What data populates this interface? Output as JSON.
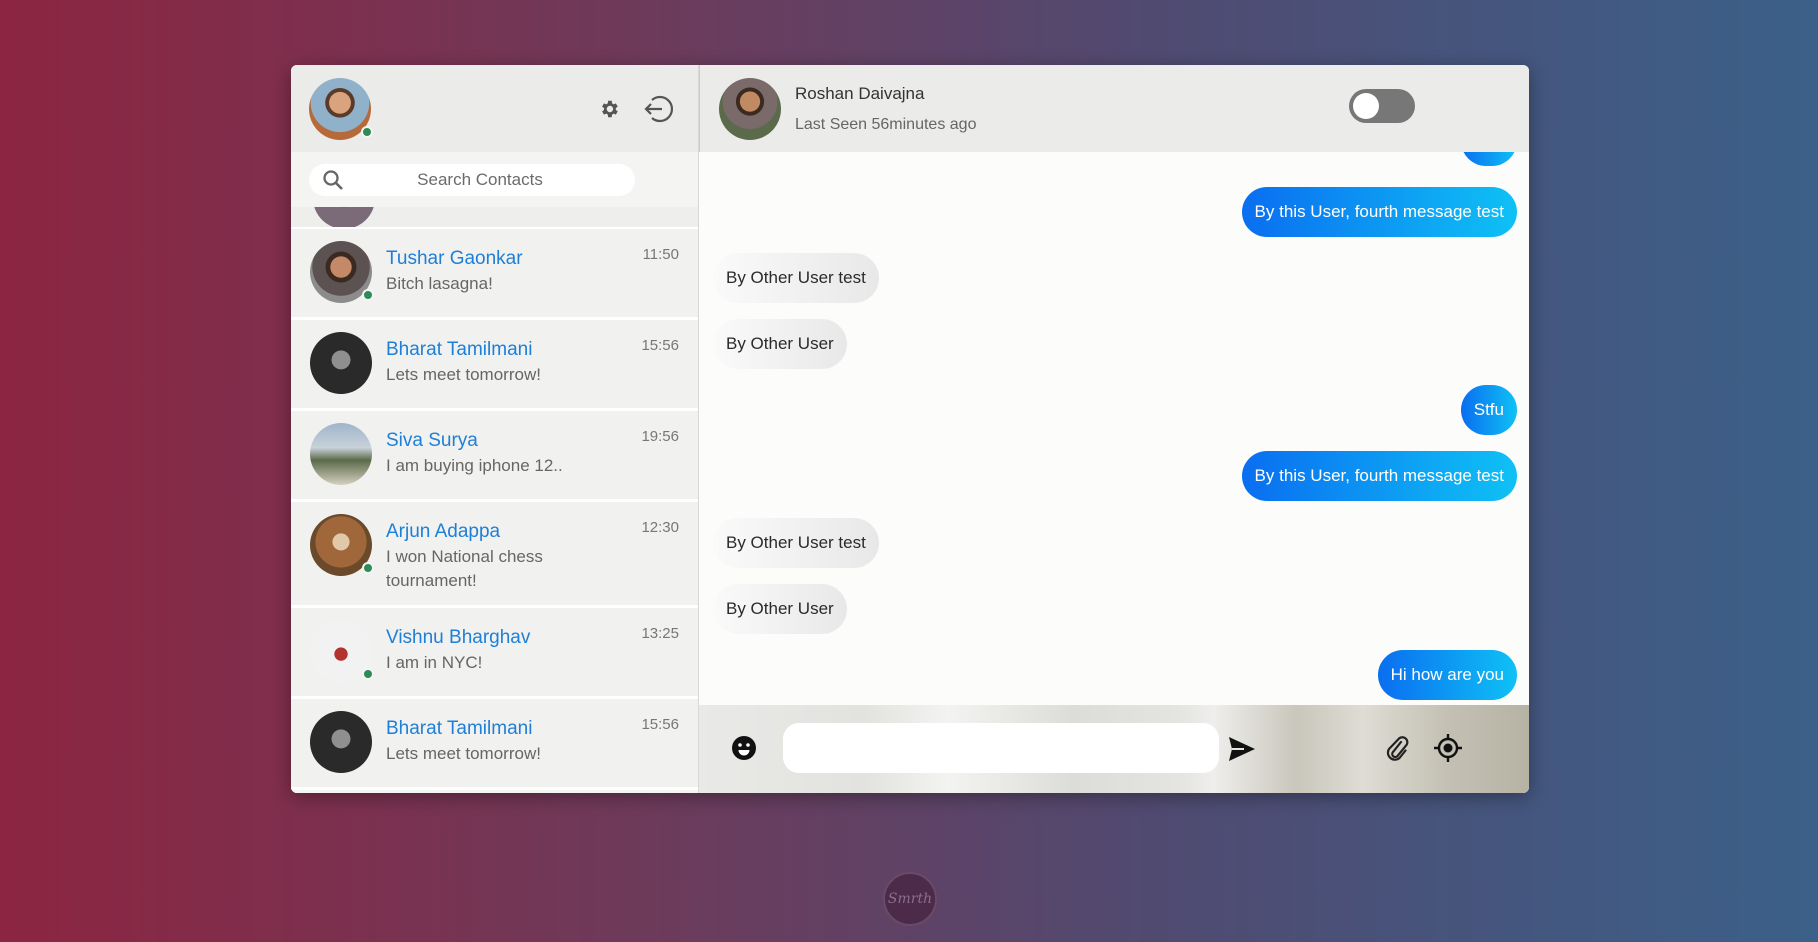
{
  "sidebar": {
    "search": {
      "placeholder": "Search Contacts"
    },
    "contacts": [
      {
        "name": "Tushar Gaonkar",
        "message": "Bitch lasagna!",
        "time": "11:50",
        "online": true
      },
      {
        "name": "Bharat Tamilmani",
        "message": "Lets meet tomorrow!",
        "time": "15:56",
        "online": false
      },
      {
        "name": "Siva Surya",
        "message": "I am buying iphone 12..",
        "time": "19:56",
        "online": false
      },
      {
        "name": "Arjun Adappa",
        "message": "I won National chess tournament!",
        "time": "12:30",
        "online": true
      },
      {
        "name": "Vishnu Bharghav",
        "message": "I am in NYC!",
        "time": "13:25",
        "online": true
      },
      {
        "name": "Bharat Tamilmani",
        "message": "Lets meet tomorrow!",
        "time": "15:56",
        "online": false
      }
    ]
  },
  "chat": {
    "contact_name": "Roshan Daivajna",
    "last_seen": "Last Seen 56minutes ago",
    "messages": [
      {
        "text": "By this User, fourth message test",
        "direction": "out"
      },
      {
        "text": "By Other User test",
        "direction": "in"
      },
      {
        "text": "By Other User",
        "direction": "in"
      },
      {
        "text": "Stfu",
        "direction": "out"
      },
      {
        "text": "By this User, fourth message test",
        "direction": "out"
      },
      {
        "text": "By Other User test",
        "direction": "in"
      },
      {
        "text": "By Other User",
        "direction": "in"
      },
      {
        "text": "Hi how are you",
        "direction": "out"
      }
    ],
    "composer": {
      "value": ""
    }
  },
  "colors": {
    "accent": "#1e7fd8",
    "online": "#2e8b57",
    "outgoing_start": "#0a6ef0",
    "outgoing_end": "#0fc1f5"
  },
  "icons": [
    "settings-gear-icon",
    "logout-icon",
    "search-icon",
    "emoji-icon",
    "send-icon",
    "attach-paperclip-icon",
    "location-target-icon"
  ]
}
